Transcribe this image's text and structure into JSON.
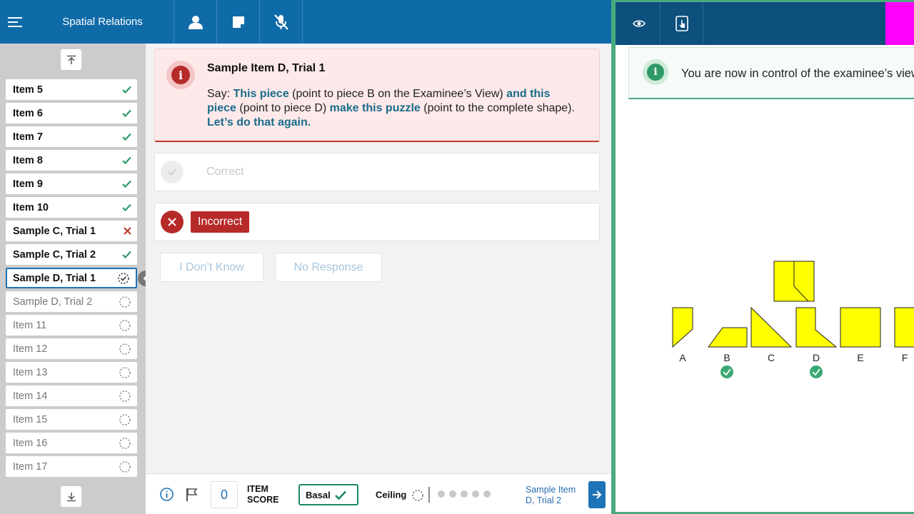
{
  "app": {
    "title": "Spatial Relations"
  },
  "header": {
    "menu_icon": "hamburger-menu-icon",
    "buttons": [
      {
        "icon": "person-icon"
      },
      {
        "icon": "note-icon"
      },
      {
        "icon": "microphone-off-icon"
      }
    ]
  },
  "sidebar": {
    "items": [
      {
        "label": "Item 5",
        "status": "correct"
      },
      {
        "label": "Item 6",
        "status": "correct"
      },
      {
        "label": "Item 7",
        "status": "correct"
      },
      {
        "label": "Item 8",
        "status": "correct"
      },
      {
        "label": "Item 9",
        "status": "correct"
      },
      {
        "label": "Item 10",
        "status": "correct"
      },
      {
        "label": "Sample C, Trial 1",
        "status": "incorrect"
      },
      {
        "label": "Sample C, Trial 2",
        "status": "correct"
      },
      {
        "label": "Sample D, Trial 1",
        "status": "current"
      },
      {
        "label": "Sample D, Trial 2",
        "status": "pending"
      },
      {
        "label": "Item 11",
        "status": "pending"
      },
      {
        "label": "Item 12",
        "status": "pending"
      },
      {
        "label": "Item 13",
        "status": "pending"
      },
      {
        "label": "Item 14",
        "status": "pending"
      },
      {
        "label": "Item 15",
        "status": "pending"
      },
      {
        "label": "Item 16",
        "status": "pending"
      },
      {
        "label": "Item 17",
        "status": "pending"
      }
    ]
  },
  "alert": {
    "title": "Sample Item D, Trial 1",
    "say": "Say: ",
    "p1": "This piece",
    "t1": " (point to piece B on the Examinee’s View) ",
    "p2": "and this piece",
    "t2": " (point to piece D) ",
    "p3": "make this puzzle",
    "t3": " (point to the complete shape). ",
    "p4": "Let’s do that again."
  },
  "responses": {
    "correct": "Correct",
    "incorrect": "Incorrect",
    "dont_know": "I Don’t Know",
    "no_response": "No Response"
  },
  "bottom": {
    "score_value": "0",
    "score_label_1": "ITEM",
    "score_label_2": "SCORE",
    "basal": "Basal",
    "ceiling": "Ceiling",
    "next_label": "Sample Item D, Trial 2"
  },
  "examinee_view": {
    "info_text": "You are now in control of the examinee’s view",
    "pieces": [
      "A",
      "B",
      "C",
      "D",
      "E",
      "F"
    ],
    "selected_pieces": [
      "B",
      "D"
    ],
    "colors": {
      "piece_fill": "#ffff00",
      "selected_badge": "#3aa872"
    }
  },
  "colors": {
    "primary": "#0f6aa8",
    "correct": "#2e9a68",
    "incorrect": "#b72a2a",
    "magenta": "#ff00ff"
  }
}
